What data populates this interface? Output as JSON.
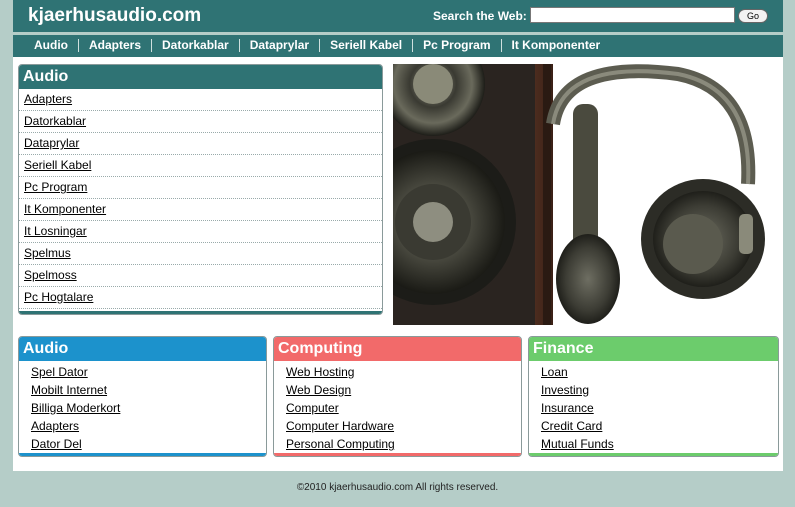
{
  "header": {
    "logo": "kjaerhusaudio.com",
    "search_label": "Search the Web:",
    "search_value": "",
    "go_label": "Go"
  },
  "nav": [
    "Audio",
    "Adapters",
    "Datorkablar",
    "Dataprylar",
    "Seriell Kabel",
    "Pc Program",
    "It Komponenter"
  ],
  "main_box": {
    "title": "Audio",
    "items": [
      "Adapters",
      "Datorkablar",
      "Dataprylar",
      "Seriell Kabel",
      "Pc Program",
      "It Komponenter",
      "It Losningar",
      "Spelmus",
      "Spelmoss",
      "Pc Hogtalare"
    ]
  },
  "boxes": {
    "audio": {
      "title": "Audio",
      "color": "#1c92cc",
      "items": [
        "Spel Dator",
        "Mobilt Internet",
        "Billiga Moderkort",
        "Adapters",
        "Dator Del"
      ]
    },
    "computing": {
      "title": "Computing",
      "color": "#f26a6a",
      "items": [
        "Web Hosting",
        "Web Design",
        "Computer",
        "Computer Hardware",
        "Personal Computing"
      ]
    },
    "finance": {
      "title": "Finance",
      "color": "#6ccc6c",
      "items": [
        "Loan",
        "Investing",
        "Insurance",
        "Credit Card",
        "Mutual Funds"
      ]
    }
  },
  "colors": {
    "brand": "#2f7374",
    "background": "#b5cdc8"
  },
  "footer": "©2010 kjaerhusaudio.com All rights reserved."
}
